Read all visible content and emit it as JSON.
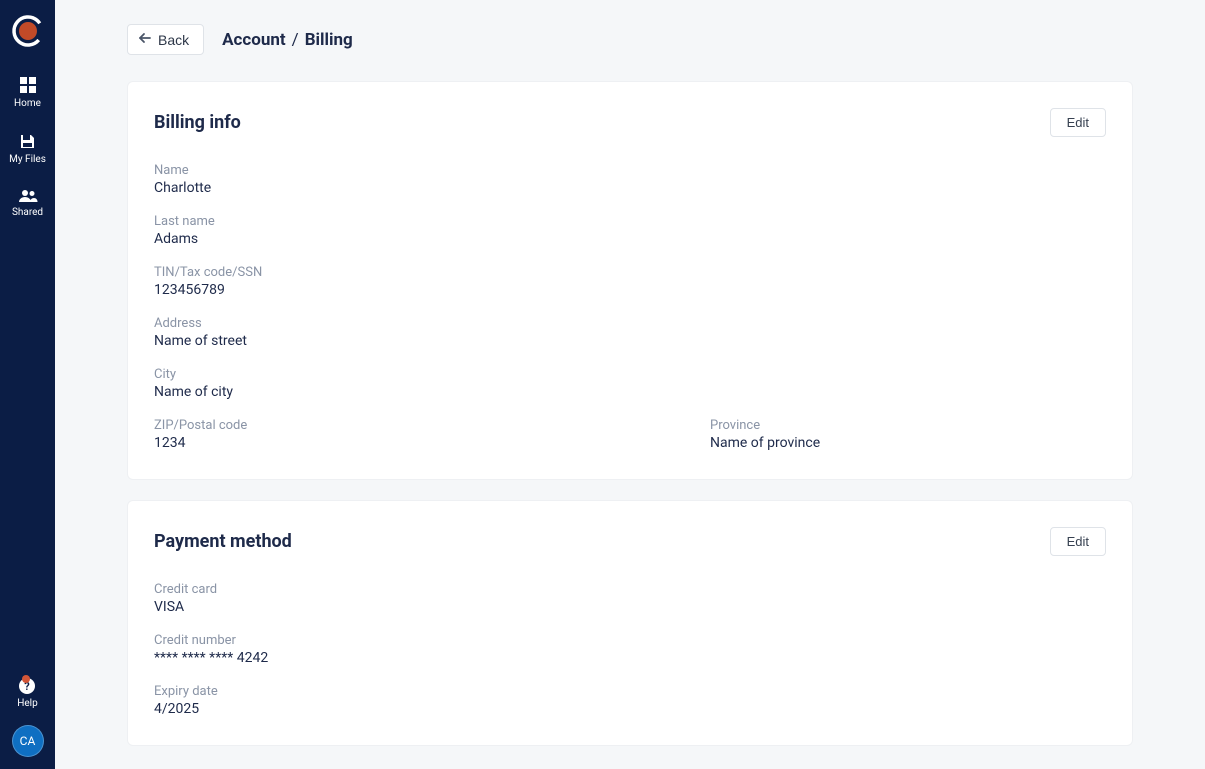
{
  "sidebar": {
    "items": [
      {
        "label": "Home"
      },
      {
        "label": "My Files"
      },
      {
        "label": "Shared"
      }
    ],
    "help_label": "Help",
    "avatar_initials": "CA"
  },
  "header": {
    "back_label": "Back",
    "breadcrumb_parent": "Account",
    "breadcrumb_sep": "/",
    "breadcrumb_current": "Billing"
  },
  "billing_card": {
    "title": "Billing info",
    "edit_label": "Edit",
    "fields": {
      "name_label": "Name",
      "name_value": "Charlotte",
      "last_name_label": "Last name",
      "last_name_value": "Adams",
      "tin_label": "TIN/Tax code/SSN",
      "tin_value": "123456789",
      "address_label": "Address",
      "address_value": "Name of street",
      "city_label": "City",
      "city_value": "Name of city",
      "zip_label": "ZIP/Postal code",
      "zip_value": "1234",
      "province_label": "Province",
      "province_value": "Name of province"
    }
  },
  "payment_card": {
    "title": "Payment method",
    "edit_label": "Edit",
    "fields": {
      "card_label": "Credit card",
      "card_value": "VISA",
      "number_label": "Credit number",
      "number_value": "**** **** **** 4242",
      "expiry_label": "Expiry date",
      "expiry_value": "4/2025"
    }
  }
}
